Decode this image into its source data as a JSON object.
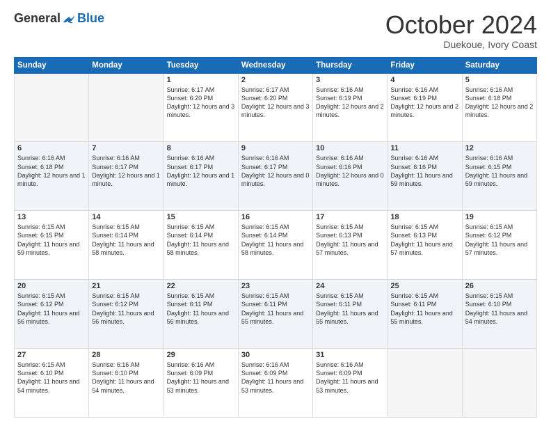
{
  "logo": {
    "general": "General",
    "blue": "Blue"
  },
  "title": "October 2024",
  "location": "Duekoue, Ivory Coast",
  "days_header": [
    "Sunday",
    "Monday",
    "Tuesday",
    "Wednesday",
    "Thursday",
    "Friday",
    "Saturday"
  ],
  "weeks": [
    [
      {
        "day": "",
        "sunrise": "",
        "sunset": "",
        "daylight": ""
      },
      {
        "day": "",
        "sunrise": "",
        "sunset": "",
        "daylight": ""
      },
      {
        "day": "1",
        "sunrise": "Sunrise: 6:17 AM",
        "sunset": "Sunset: 6:20 PM",
        "daylight": "Daylight: 12 hours and 3 minutes."
      },
      {
        "day": "2",
        "sunrise": "Sunrise: 6:17 AM",
        "sunset": "Sunset: 6:20 PM",
        "daylight": "Daylight: 12 hours and 3 minutes."
      },
      {
        "day": "3",
        "sunrise": "Sunrise: 6:16 AM",
        "sunset": "Sunset: 6:19 PM",
        "daylight": "Daylight: 12 hours and 2 minutes."
      },
      {
        "day": "4",
        "sunrise": "Sunrise: 6:16 AM",
        "sunset": "Sunset: 6:19 PM",
        "daylight": "Daylight: 12 hours and 2 minutes."
      },
      {
        "day": "5",
        "sunrise": "Sunrise: 6:16 AM",
        "sunset": "Sunset: 6:18 PM",
        "daylight": "Daylight: 12 hours and 2 minutes."
      }
    ],
    [
      {
        "day": "6",
        "sunrise": "Sunrise: 6:16 AM",
        "sunset": "Sunset: 6:18 PM",
        "daylight": "Daylight: 12 hours and 1 minute."
      },
      {
        "day": "7",
        "sunrise": "Sunrise: 6:16 AM",
        "sunset": "Sunset: 6:17 PM",
        "daylight": "Daylight: 12 hours and 1 minute."
      },
      {
        "day": "8",
        "sunrise": "Sunrise: 6:16 AM",
        "sunset": "Sunset: 6:17 PM",
        "daylight": "Daylight: 12 hours and 1 minute."
      },
      {
        "day": "9",
        "sunrise": "Sunrise: 6:16 AM",
        "sunset": "Sunset: 6:17 PM",
        "daylight": "Daylight: 12 hours and 0 minutes."
      },
      {
        "day": "10",
        "sunrise": "Sunrise: 6:16 AM",
        "sunset": "Sunset: 6:16 PM",
        "daylight": "Daylight: 12 hours and 0 minutes."
      },
      {
        "day": "11",
        "sunrise": "Sunrise: 6:16 AM",
        "sunset": "Sunset: 6:16 PM",
        "daylight": "Daylight: 11 hours and 59 minutes."
      },
      {
        "day": "12",
        "sunrise": "Sunrise: 6:16 AM",
        "sunset": "Sunset: 6:15 PM",
        "daylight": "Daylight: 11 hours and 59 minutes."
      }
    ],
    [
      {
        "day": "13",
        "sunrise": "Sunrise: 6:15 AM",
        "sunset": "Sunset: 6:15 PM",
        "daylight": "Daylight: 11 hours and 59 minutes."
      },
      {
        "day": "14",
        "sunrise": "Sunrise: 6:15 AM",
        "sunset": "Sunset: 6:14 PM",
        "daylight": "Daylight: 11 hours and 58 minutes."
      },
      {
        "day": "15",
        "sunrise": "Sunrise: 6:15 AM",
        "sunset": "Sunset: 6:14 PM",
        "daylight": "Daylight: 11 hours and 58 minutes."
      },
      {
        "day": "16",
        "sunrise": "Sunrise: 6:15 AM",
        "sunset": "Sunset: 6:14 PM",
        "daylight": "Daylight: 11 hours and 58 minutes."
      },
      {
        "day": "17",
        "sunrise": "Sunrise: 6:15 AM",
        "sunset": "Sunset: 6:13 PM",
        "daylight": "Daylight: 11 hours and 57 minutes."
      },
      {
        "day": "18",
        "sunrise": "Sunrise: 6:15 AM",
        "sunset": "Sunset: 6:13 PM",
        "daylight": "Daylight: 11 hours and 57 minutes."
      },
      {
        "day": "19",
        "sunrise": "Sunrise: 6:15 AM",
        "sunset": "Sunset: 6:12 PM",
        "daylight": "Daylight: 11 hours and 57 minutes."
      }
    ],
    [
      {
        "day": "20",
        "sunrise": "Sunrise: 6:15 AM",
        "sunset": "Sunset: 6:12 PM",
        "daylight": "Daylight: 11 hours and 56 minutes."
      },
      {
        "day": "21",
        "sunrise": "Sunrise: 6:15 AM",
        "sunset": "Sunset: 6:12 PM",
        "daylight": "Daylight: 11 hours and 56 minutes."
      },
      {
        "day": "22",
        "sunrise": "Sunrise: 6:15 AM",
        "sunset": "Sunset: 6:11 PM",
        "daylight": "Daylight: 11 hours and 56 minutes."
      },
      {
        "day": "23",
        "sunrise": "Sunrise: 6:15 AM",
        "sunset": "Sunset: 6:11 PM",
        "daylight": "Daylight: 11 hours and 55 minutes."
      },
      {
        "day": "24",
        "sunrise": "Sunrise: 6:15 AM",
        "sunset": "Sunset: 6:11 PM",
        "daylight": "Daylight: 11 hours and 55 minutes."
      },
      {
        "day": "25",
        "sunrise": "Sunrise: 6:15 AM",
        "sunset": "Sunset: 6:11 PM",
        "daylight": "Daylight: 11 hours and 55 minutes."
      },
      {
        "day": "26",
        "sunrise": "Sunrise: 6:15 AM",
        "sunset": "Sunset: 6:10 PM",
        "daylight": "Daylight: 11 hours and 54 minutes."
      }
    ],
    [
      {
        "day": "27",
        "sunrise": "Sunrise: 6:15 AM",
        "sunset": "Sunset: 6:10 PM",
        "daylight": "Daylight: 11 hours and 54 minutes."
      },
      {
        "day": "28",
        "sunrise": "Sunrise: 6:16 AM",
        "sunset": "Sunset: 6:10 PM",
        "daylight": "Daylight: 11 hours and 54 minutes."
      },
      {
        "day": "29",
        "sunrise": "Sunrise: 6:16 AM",
        "sunset": "Sunset: 6:09 PM",
        "daylight": "Daylight: 11 hours and 53 minutes."
      },
      {
        "day": "30",
        "sunrise": "Sunrise: 6:16 AM",
        "sunset": "Sunset: 6:09 PM",
        "daylight": "Daylight: 11 hours and 53 minutes."
      },
      {
        "day": "31",
        "sunrise": "Sunrise: 6:16 AM",
        "sunset": "Sunset: 6:09 PM",
        "daylight": "Daylight: 11 hours and 53 minutes."
      },
      {
        "day": "",
        "sunrise": "",
        "sunset": "",
        "daylight": ""
      },
      {
        "day": "",
        "sunrise": "",
        "sunset": "",
        "daylight": ""
      }
    ]
  ]
}
